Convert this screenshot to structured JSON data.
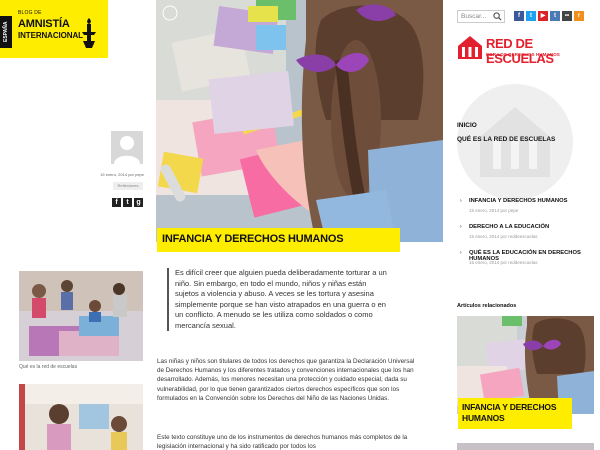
{
  "brand": {
    "blog_label": "BLOG DE",
    "name_line1": "AMNISTÍA",
    "name_line2": "INTERNACIONAL",
    "country": "ESPAÑA",
    "color": "#ffed00"
  },
  "search": {
    "placeholder": "Buscar..."
  },
  "social": [
    {
      "icon": "facebook-icon",
      "glyph": "f",
      "color": "#3b5998"
    },
    {
      "icon": "twitter-icon",
      "glyph": "t",
      "color": "#1da1f2"
    },
    {
      "icon": "youtube-icon",
      "glyph": "▶",
      "color": "#d9252a"
    },
    {
      "icon": "tuenti-icon",
      "glyph": "t",
      "color": "#4b7ab5"
    },
    {
      "icon": "flickr-icon",
      "glyph": "••",
      "color": "#444"
    },
    {
      "icon": "rss-icon",
      "glyph": "r",
      "color": "#f28e1c"
    }
  ],
  "partner": {
    "line1": "RED DE ESCUELAS",
    "line2": "POR LOS DERECHOS HUMANOS",
    "color": "#e3202d"
  },
  "author": {
    "meta": "15 enero, 2014 por pepe",
    "tag": "Reflexiones"
  },
  "post": {
    "title": "INFANCIA Y DERECHOS HUMANOS",
    "lead": "Es difícil creer que alguien pueda deliberadamente torturar a un niño. Sin embargo, en todo el mundo, niños y niñas están sujetos a violencia y abuso. A veces se les tortura y asesina simplemente porque se han visto atrapados en una guerra o en un conflicto. A menudo se les utiliza como soldados o como mercancía sexual.",
    "paragraph1": "Las niñas y niños son titulares de todos los derechos que garantiza la Declaración Universal de Derechos Humanos y los diferentes tratados y convenciones internacionales que los han desarrollado. Además, los menores necesitan una protección y cuidado especial, dada su vulnerabilidad, por lo que tienen garantizados ciertos derechos específicos que son los formulados en la Convención sobre los Derechos del Niño de las Naciones Unidas.",
    "paragraph2": "Este texto constituye uno de los instrumentos de derechos humanos más completos de la legislación internacional y ha sido ratificado por todos los"
  },
  "left": {
    "caption": "Qué es la red de escuelas"
  },
  "sidebar": {
    "nav": [
      "INICIO",
      "QUÉ ES LA RED DE ESCUELAS"
    ],
    "links": [
      {
        "title": "INFANCIA Y DERECHOS HUMANOS",
        "meta": "15 enero, 2014 por pepe"
      },
      {
        "title": "DERECHO A LA EDUCACIÓN",
        "meta": "15 enero, 2014 por reddeescuelas"
      },
      {
        "title": "QUÉ ES LA EDUCACIÓN EN DERECHOS HUMANOS",
        "meta": "15 enero, 2014 por reddeescuelas"
      }
    ],
    "related_label": "Artículos relacionados",
    "related_title": "INFANCIA Y DERECHOS HUMANOS"
  }
}
